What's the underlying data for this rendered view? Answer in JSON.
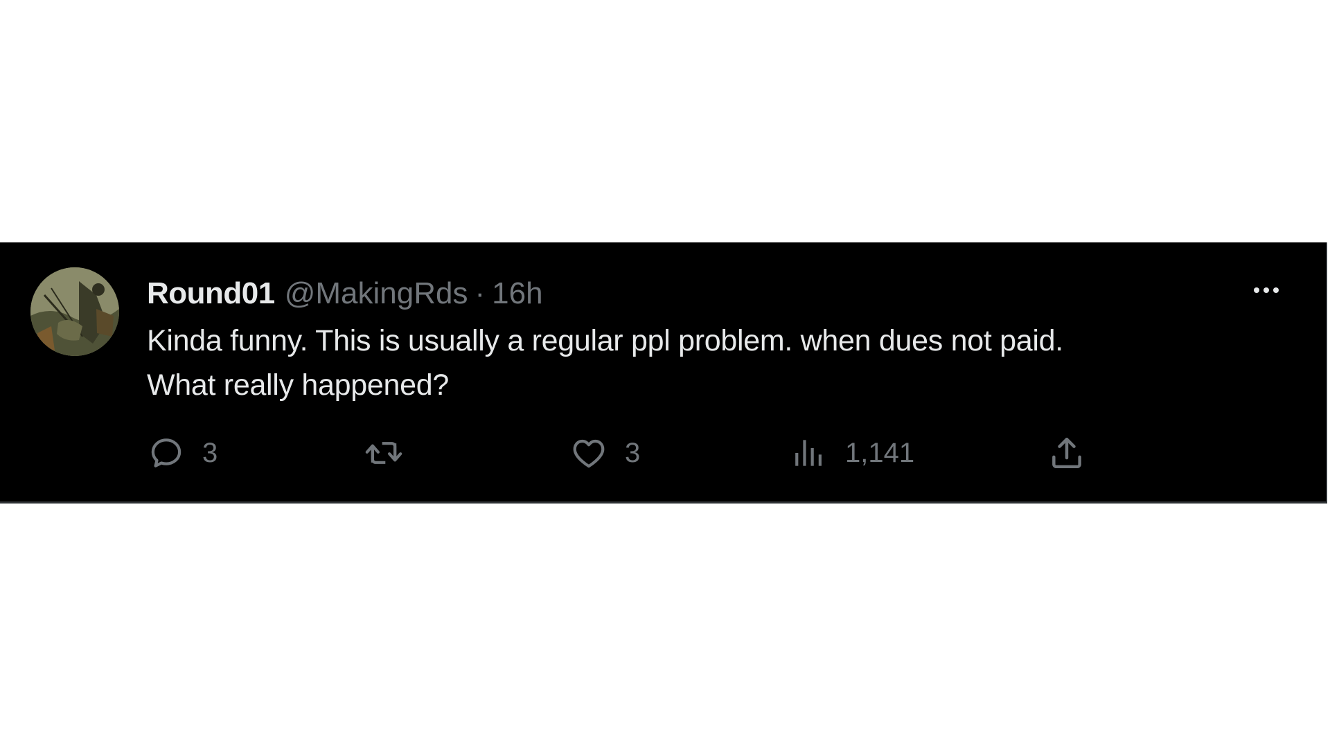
{
  "tweet": {
    "author": {
      "display_name": "Round01",
      "handle": "@MakingRds"
    },
    "separator": "·",
    "timestamp": "16h",
    "text_lines": [
      "Kinda funny. This is usually a regular ppl problem. when dues not paid.",
      "What really happened?"
    ],
    "actions": {
      "reply": {
        "icon": "reply-icon",
        "count": "3"
      },
      "retweet": {
        "icon": "retweet-icon",
        "count": ""
      },
      "like": {
        "icon": "heart-icon",
        "count": "3"
      },
      "views": {
        "icon": "analytics-icon",
        "count": "1,141"
      },
      "share": {
        "icon": "share-icon"
      }
    },
    "more_icon": "more-horizontal-icon"
  },
  "colors": {
    "background": "#000000",
    "primary_text": "#e7e9ea",
    "secondary_text": "#71767b",
    "page_background": "#ffffff",
    "border": "#2f3336"
  }
}
